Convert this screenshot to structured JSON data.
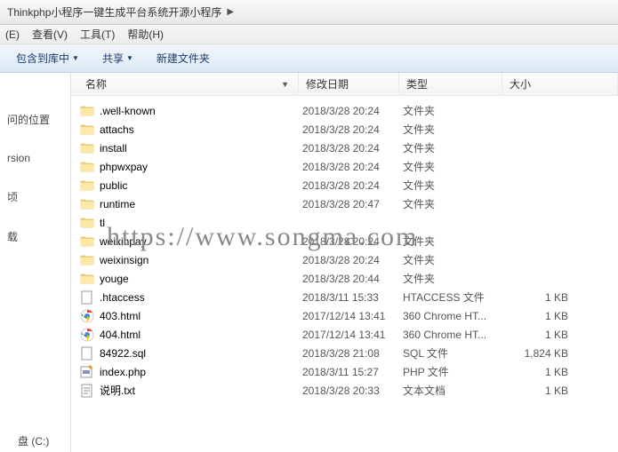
{
  "address": {
    "path": "Thinkphp小程序一键生成平台系统开源小程序",
    "arrow": "▶"
  },
  "menu": {
    "items": [
      "(E)",
      "查看(V)",
      "工具(T)",
      "帮助(H)"
    ]
  },
  "toolbar": {
    "include": "包含到库中",
    "share": "共享",
    "newfolder": "新建文件夹"
  },
  "nav": {
    "recent": "问的位置",
    "rsion": "rsion",
    "freq": "顷",
    "down": "载",
    "drive": "盘 (C:)"
  },
  "columns": {
    "name": "名称",
    "date": "修改日期",
    "type": "类型",
    "size": "大小"
  },
  "files": [
    {
      "name": ".well-known",
      "date": "2018/3/28 20:24",
      "type": "文件夹",
      "size": "",
      "icon": "folder"
    },
    {
      "name": "attachs",
      "date": "2018/3/28 20:24",
      "type": "文件夹",
      "size": "",
      "icon": "folder"
    },
    {
      "name": "install",
      "date": "2018/3/28 20:24",
      "type": "文件夹",
      "size": "",
      "icon": "folder"
    },
    {
      "name": "phpwxpay",
      "date": "2018/3/28 20:24",
      "type": "文件夹",
      "size": "",
      "icon": "folder"
    },
    {
      "name": "public",
      "date": "2018/3/28 20:24",
      "type": "文件夹",
      "size": "",
      "icon": "folder"
    },
    {
      "name": "runtime",
      "date": "2018/3/28 20:47",
      "type": "文件夹",
      "size": "",
      "icon": "folder"
    },
    {
      "name": "tl",
      "date": "",
      "type": "",
      "size": "",
      "icon": "folder"
    },
    {
      "name": "weixinpay",
      "date": "2018/3/28 20:24",
      "type": "文件夹",
      "size": "",
      "icon": "folder"
    },
    {
      "name": "weixinsign",
      "date": "2018/3/28 20:24",
      "type": "文件夹",
      "size": "",
      "icon": "folder"
    },
    {
      "name": "youge",
      "date": "2018/3/28 20:44",
      "type": "文件夹",
      "size": "",
      "icon": "folder"
    },
    {
      "name": ".htaccess",
      "date": "2018/3/11 15:33",
      "type": "HTACCESS 文件",
      "size": "1 KB",
      "icon": "file"
    },
    {
      "name": "403.html",
      "date": "2017/12/14 13:41",
      "type": "360 Chrome HT...",
      "size": "1 KB",
      "icon": "chrome"
    },
    {
      "name": "404.html",
      "date": "2017/12/14 13:41",
      "type": "360 Chrome HT...",
      "size": "1 KB",
      "icon": "chrome"
    },
    {
      "name": "84922.sql",
      "date": "2018/3/28 21:08",
      "type": "SQL 文件",
      "size": "1,824 KB",
      "icon": "file"
    },
    {
      "name": "index.php",
      "date": "2018/3/11 15:27",
      "type": "PHP 文件",
      "size": "1 KB",
      "icon": "php"
    },
    {
      "name": "说明.txt",
      "date": "2018/3/28 20:33",
      "type": "文本文档",
      "size": "1 KB",
      "icon": "txt"
    }
  ],
  "watermark": "https://www.songma.com"
}
